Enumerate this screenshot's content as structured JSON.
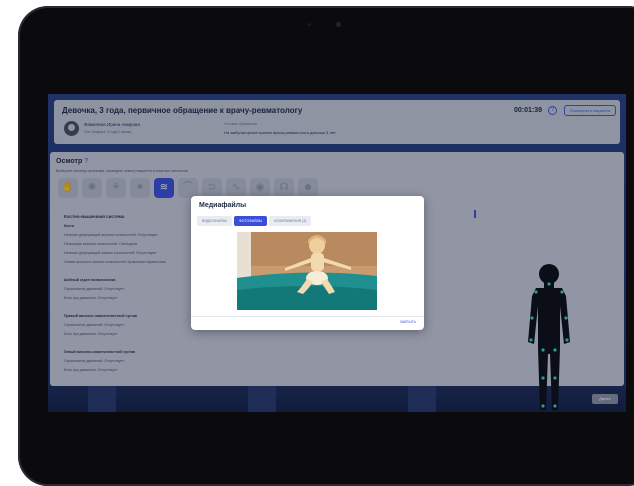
{
  "header": {
    "case_title": "Девочка, 3 года, первичное обращение к врачу-ревматологу",
    "timer": "00:01:39",
    "help_symbol": "?",
    "back_button": "Посмотреть пациента",
    "patient_name": "Фамилина Ирина Амирова",
    "patient_meta": "Пол:  Возраст: 3 года 1 месяц",
    "diagnosis_label": "Условие обращения",
    "diagnosis_value": "На амбулаторном приеме врача-ревматолога девочка 3 лет"
  },
  "exam": {
    "title": "Осмотр",
    "help_symbol": "?",
    "subtitle": "Выберите систему организма, проведите осмотр пациента и отметьте патологию",
    "system_icons": [
      "skin-icon",
      "lymph-icon",
      "lungs-icon",
      "heart-icon",
      "spine-icon",
      "digestive-icon",
      "kidney-icon",
      "nerve-icon",
      "eye-icon",
      "ear-icon",
      "head-icon"
    ],
    "active_system_label": "ОДС",
    "section_title": "Костно-мышечная система",
    "items": [
      {
        "text": "Кости",
        "heading": true
      },
      {
        "text": "Наличие деформаций верхних конечностей: Отсутствуют",
        "heading": false
      },
      {
        "text": "Пальпация верхних конечностей: Свободная",
        "heading": false
      },
      {
        "text": "Наличие деформаций нижних конечностей: Отсутствуют",
        "heading": false
      },
      {
        "text": "Симметричность нижних конечностей: Кровлевая нормальная",
        "heading": false
      },
      {
        "text": "",
        "heading": false
      },
      {
        "text": "Шейный отдел позвоночника",
        "heading": true
      },
      {
        "text": "Ограничение движений: Отсутствует",
        "heading": false
      },
      {
        "text": "Боль при движении: Отсутствует",
        "heading": false
      },
      {
        "text": "",
        "heading": false
      },
      {
        "text": "Правый височно-нижнечелюстной сустав",
        "heading": true
      },
      {
        "text": "Ограничение движений: Отсутствует",
        "heading": false
      },
      {
        "text": "Боль при движении: Отсутствует",
        "heading": false
      },
      {
        "text": "",
        "heading": false
      },
      {
        "text": "Левый височно-нижнечелюстной сустав",
        "heading": true
      },
      {
        "text": "Ограничение движений: Отсутствует",
        "heading": false
      },
      {
        "text": "Боль при движении: Отсутствует",
        "heading": false
      }
    ],
    "done_button": "Далее"
  },
  "modal": {
    "title": "Медиафайлы",
    "tabs": [
      {
        "label": "ВИДЕОФАЙЛЫ",
        "active": false
      },
      {
        "label": "ФОТОФАЙЛЫ",
        "active": true
      },
      {
        "label": "ИЗОБРАЖЕНИЯ (3)",
        "active": false
      }
    ],
    "close_label": "ЗАКРЫТЬ"
  },
  "colors": {
    "accent": "#3a4fd9",
    "screen_bg": "#1f3776",
    "panel": "#c5cad6"
  }
}
